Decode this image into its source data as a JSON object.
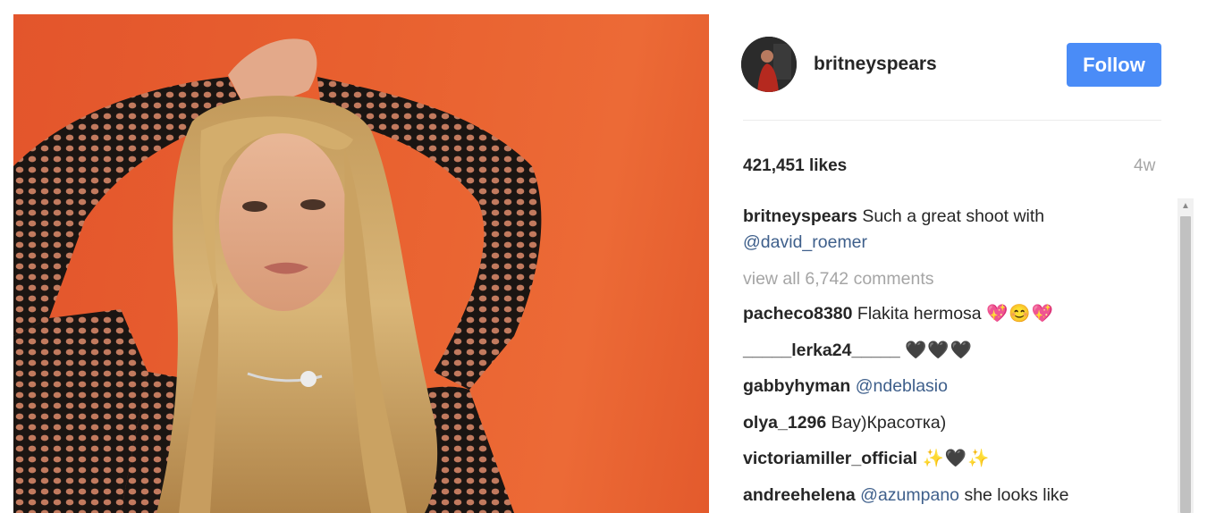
{
  "post": {
    "photo_alt": "",
    "author": {
      "username": "britneyspears",
      "follow_label": "Follow"
    },
    "likes": "421,451 likes",
    "age": "4w",
    "caption": {
      "username": "britneyspears",
      "text_line1": "Such a great shoot with",
      "mention": "@david_roemer"
    },
    "view_all_comments": "view all 6,742 comments",
    "comments": [
      {
        "username": "pacheco8380",
        "text": "Flakita hermosa",
        "emoji": "💖😊💖"
      },
      {
        "username": "_____lerka24_____",
        "text": "",
        "emoji": "🖤🖤🖤"
      },
      {
        "username": "gabbyhyman",
        "mention": "@ndeblasio"
      },
      {
        "username": "olya_1296",
        "text": "Вау)Красотка)"
      },
      {
        "username": "victoriamiller_official",
        "text": "",
        "emoji": "✨🖤✨"
      },
      {
        "username": "andreehelena",
        "mention": "@azumpano",
        "text": "she looks like"
      }
    ]
  },
  "colors": {
    "follow_button": "#4a8cf7",
    "mention": "#3e5f8b",
    "muted_text": "#a5a5a5",
    "photo_background": "#e8602f"
  },
  "icons": {
    "scroll_up": "chevron-up-icon"
  }
}
